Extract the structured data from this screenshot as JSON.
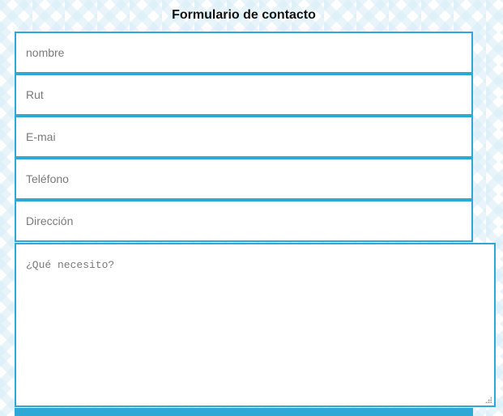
{
  "form": {
    "title": "Formulario de contacto",
    "fields": [
      {
        "placeholder": "nombre"
      },
      {
        "placeholder": "Rut"
      },
      {
        "placeholder": "E-mai"
      },
      {
        "placeholder": "Teléfono"
      },
      {
        "placeholder": "Dirección"
      }
    ],
    "message_placeholder": "¿Qué necesito?"
  },
  "colors": {
    "accent": "#2fa8d6",
    "background_pattern": "#d6ecf6",
    "text": "#111111",
    "placeholder": "#7a7a7a"
  },
  "icons": [
    "resize-grip-icon"
  ]
}
